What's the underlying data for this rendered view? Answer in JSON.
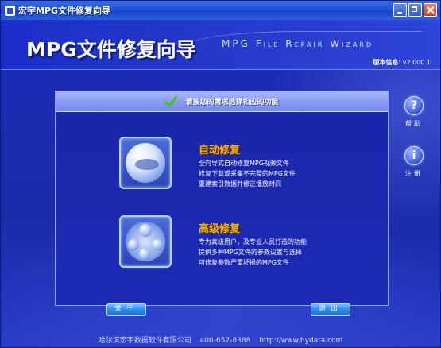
{
  "window": {
    "title": "宏宇MPG文件修复向导"
  },
  "header": {
    "title": "MPG文件修复向导",
    "subtitle_en": "MPG File Repair Wizard",
    "version_label": "版本信息:",
    "version_value": "v2.000.1"
  },
  "panel": {
    "instruction": "请按您的需求选择相应的功能"
  },
  "options": [
    {
      "title": "自动修复",
      "lines": [
        "全向导式自动修复MPG视频文件",
        "修复下载或采集不完整的MPG文件",
        "重建索引数据并修正播放时间"
      ],
      "icon": "auto-repair-icon"
    },
    {
      "title": "高级修复",
      "lines": [
        "专为高级用户，及专业人员打造的功能",
        "提供多种MPG文件的参数设置与选择",
        "可修复参数严重坏损的MPG文件"
      ],
      "icon": "advanced-repair-icon"
    }
  ],
  "side": {
    "help_label": "帮助",
    "help_glyph": "?",
    "register_label": "注册",
    "register_glyph": "i"
  },
  "buttons": {
    "about": "关于",
    "exit": "退出"
  },
  "footer": {
    "company": "哈尔滨宏宇数据软件有限公司",
    "phone": "400-657-8388",
    "website": "http://www.hydata.com"
  },
  "colors": {
    "accent_orange": "#ffae00",
    "background_blue": "#1a2fb0"
  }
}
